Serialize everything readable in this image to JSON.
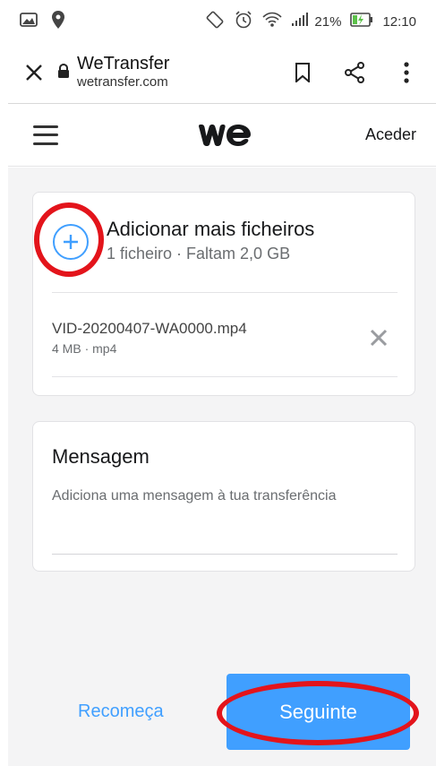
{
  "status_bar": {
    "battery_percent": "21%",
    "time": "12:10"
  },
  "browser": {
    "site_title": "WeTransfer",
    "site_url": "wetransfer.com"
  },
  "header": {
    "login_label": "Aceder"
  },
  "upload": {
    "add_title": "Adicionar mais ficheiros",
    "add_subtitle": "1 ficheiro · Faltam 2,0 GB",
    "files": [
      {
        "name": "VID-20200407-WA0000.mp4",
        "meta": "4 MB · mp4"
      }
    ]
  },
  "message": {
    "title": "Mensagem",
    "placeholder": "Adiciona uma mensagem à tua transferência",
    "value": ""
  },
  "actions": {
    "reset_label": "Recomeça",
    "next_label": "Seguinte"
  },
  "colors": {
    "accent": "#409fff",
    "annotation": "#e3141b",
    "background": "#f4f4f5"
  }
}
